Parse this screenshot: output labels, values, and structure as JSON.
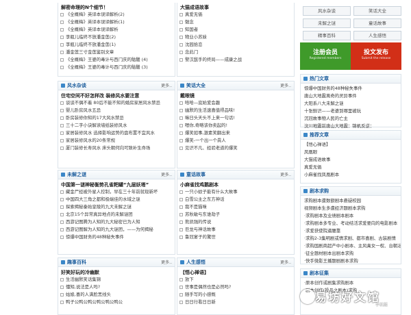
{
  "top_left": {
    "heading": "解密命理的N个细节！",
    "items": [
      "《全概梅》英译本误译解析(2)",
      "《全概梅》英译本误译解析(1)",
      "《全概梅》英译本误译解析",
      "李瓶儿临终不放潘金莲(2)",
      "李瓶儿临终不放潘金莲(1)",
      "潘金莲三寸金莲鉴别文章",
      "《全概梅》王婆的毒计与西门庆的骷髅 (4)",
      "《全概梅》王婆的毒计与西门庆的骷髅 (3)"
    ]
  },
  "top_mid": {
    "heading": "大猫成语故事",
    "items": [
      "真爱无価",
      "勉念",
      "知国者",
      "物业小苏妹",
      "沈园拾恋",
      "念此门",
      "警汉敌手的终局——成康之战"
    ]
  },
  "tags": [
    "风水杂谈",
    "笑话大全",
    "未解之谜",
    "童话故事",
    "精事百科",
    "人生感悟"
  ],
  "banner": {
    "l1": "注册会员",
    "l2": "Registered members",
    "r1": "投文发布",
    "r2": "Submit the release"
  },
  "fengshui": {
    "title": "风水杂谈",
    "more": "更多..",
    "heading": "住宅空间不好怎样改 装修风水要注意",
    "items": [
      "谈谈不偶不着 80后不能不知的婚房家居风水禁忌",
      "婴儿卧房风水五忌",
      "卧房装修你知的17大风水禁忌",
      "三十二字小诀解读墙纸装修风水",
      "家居装修风水 选择影响运势的盘布置不宜风水",
      "家居装修风水的20条常规",
      "厦门装修长寿风水 床头朝何向可致补生命场"
    ]
  },
  "jokes": {
    "title": "笑话大全",
    "more": "更多..",
    "heading": "戴眼镜",
    "items": [
      "哈哈—底始爱会趣",
      "幽默的生活速喜值得品味!",
      "嘛日头天头不上来一句话!",
      "嗯你,奇略该你卖起的!",
      "爆笑如事,激素笑翻出来",
      "爆笑-一个出一个眞人",
      "见识不凡、经验老道的爆笑"
    ]
  },
  "mysteries": {
    "title": "未解之谜",
    "more": "更多..",
    "heading": "中国第一谜神秘衡势孔雀粑罐“九层妖塔”",
    "items": [
      "藏金尸经被外星人控制，早在三十年前就现新坏",
      "中国四大三角之都和极端佳的水域之谜",
      "探索揭秘秦始皇陵的九大未解之谜",
      "北京15个异常真异地点的未解谜团",
      "西游记图腾为人知的九大秘密已为人知",
      "西游记图解为人知的九大谜团，——为何揭秘",
      "惊爆中国财务的48种秘失事件"
    ]
  },
  "fairy": {
    "title": "童话故事",
    "more": "更多..",
    "heading": "小麻雀找鸡鹅剧本",
    "items": [
      "一只小蚊子能有什么大故事",
      "白雪公主之东方神话",
      "我不是猫咪",
      "苏秋敏与东谁劫子",
      "熊凯强的传说",
      "巨龙与神话故事",
      "鲁冠宴子的驚世"
    ]
  },
  "baike": {
    "title": "趣事百科",
    "more": "更多..",
    "heading": "好笑好玩的冷幽默",
    "items": [
      "生活幽默笑话集锦",
      "懂知,说法是人吗?",
      "姑娘,喜的人满脸黑线头",
      "鸭子公鸭公鸭公鸭公鸭公鸭公"
    ]
  },
  "life": {
    "title": "人生感悟",
    "more": "更多..",
    "heading": "【悟心禅语】",
    "items": [
      "放下",
      "世事是偶然也是必然吗?",
      "随手写的小感慨",
      "日日行看日日新"
    ]
  },
  "hot": {
    "title": "热门文章",
    "items": [
      "惊爆中国财务的48种秘失事件",
      "唐山大地震离奇的灵异事件",
      "大阳系八大未解之谜",
      "十张鲜识——老婆到哪里被玩",
      "沉冠故事物人民的亡主",
      "汶川地震前唐山大地震：锦帆反逆："
    ]
  },
  "rec": {
    "title": "推荐文章",
    "items": [
      "【悟心禅语】",
      "凤凰眼",
      "大猫成语故事",
      "真爱无価",
      "小麻雀找凤凰剧本"
    ]
  },
  "script": {
    "title": "剧本求购",
    "items": [
      "求购剧本遭数额剧本悬疑校园",
      "视频剧本生多遭经济题剧本求购",
      "·求购剧本及业绩剧本剧本",
      "·求购剧本多专业、考动结活求爱要向的电影剧本",
      "·求爱获使院逼腰靠",
      "·求购2-3集明剧或情求剧、都市喜剧、古装剧情",
      "·求购国剧商超产中小剧本、主风禽女一权、台朝冶作",
      "·征全题材剧本出剧本求购",
      "·快手微影王播题剧剧本求购"
    ]
  },
  "sxxj": {
    "title": "剧本征集",
    "items": [
      "·原本创作或剧集求购剧本",
      "·剧本创作(投品之剧本)求购"
    ]
  },
  "watermark": {
    "title": "易坊好文馆",
    "sub": "手机版"
  },
  "colors": {
    "accent": "#1f5f9e",
    "border": "#dbe3ea",
    "green": "#3f9a2a",
    "red": "#d22f17"
  }
}
